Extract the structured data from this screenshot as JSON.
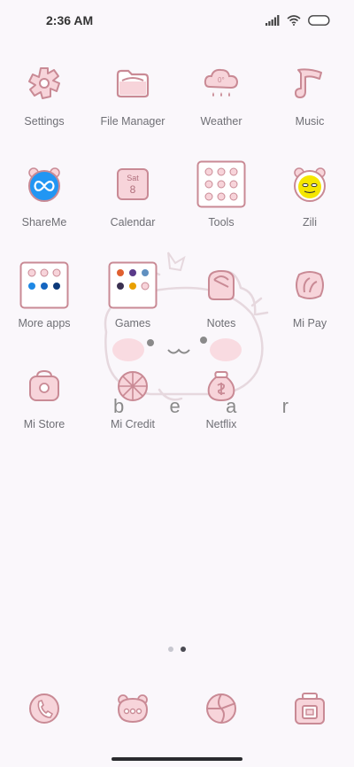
{
  "status_bar": {
    "time": "2:36 AM"
  },
  "colors": {
    "accent": "#c98a95",
    "fill": "#f7d4da",
    "shareme": "#2196f3"
  },
  "wallpaper": {
    "letters": [
      "b",
      "e",
      "a",
      "r"
    ]
  },
  "apps": [
    {
      "label": "Settings",
      "icon": "settings-icon"
    },
    {
      "label": "File Manager",
      "icon": "folder-icon"
    },
    {
      "label": "Weather",
      "icon": "weather-cloud-icon"
    },
    {
      "label": "Music",
      "icon": "music-note-icon"
    },
    {
      "label": "ShareMe",
      "icon": "shareme-infinity-icon"
    },
    {
      "label": "Calendar",
      "icon": "calendar-icon",
      "day": "Sat",
      "date": "8"
    },
    {
      "label": "Tools",
      "icon": "tools-folder-icon"
    },
    {
      "label": "Zili",
      "icon": "zili-face-icon"
    },
    {
      "label": "More apps",
      "icon": "more-apps-folder-icon"
    },
    {
      "label": "Games",
      "icon": "games-folder-icon"
    },
    {
      "label": "Notes",
      "icon": "notes-icon"
    },
    {
      "label": "Mi Pay",
      "icon": "mi-pay-icon"
    },
    {
      "label": "Mi Store",
      "icon": "mi-store-bag-icon"
    },
    {
      "label": "Mi Credit",
      "icon": "mi-credit-icon"
    },
    {
      "label": "Netflix",
      "icon": "netflix-money-bag-icon"
    }
  ],
  "dock": [
    {
      "icon": "phone-icon"
    },
    {
      "icon": "messages-bear-icon"
    },
    {
      "icon": "browser-globe-icon"
    },
    {
      "icon": "camera-icon"
    }
  ],
  "pages": {
    "count": 2,
    "active": 2
  }
}
